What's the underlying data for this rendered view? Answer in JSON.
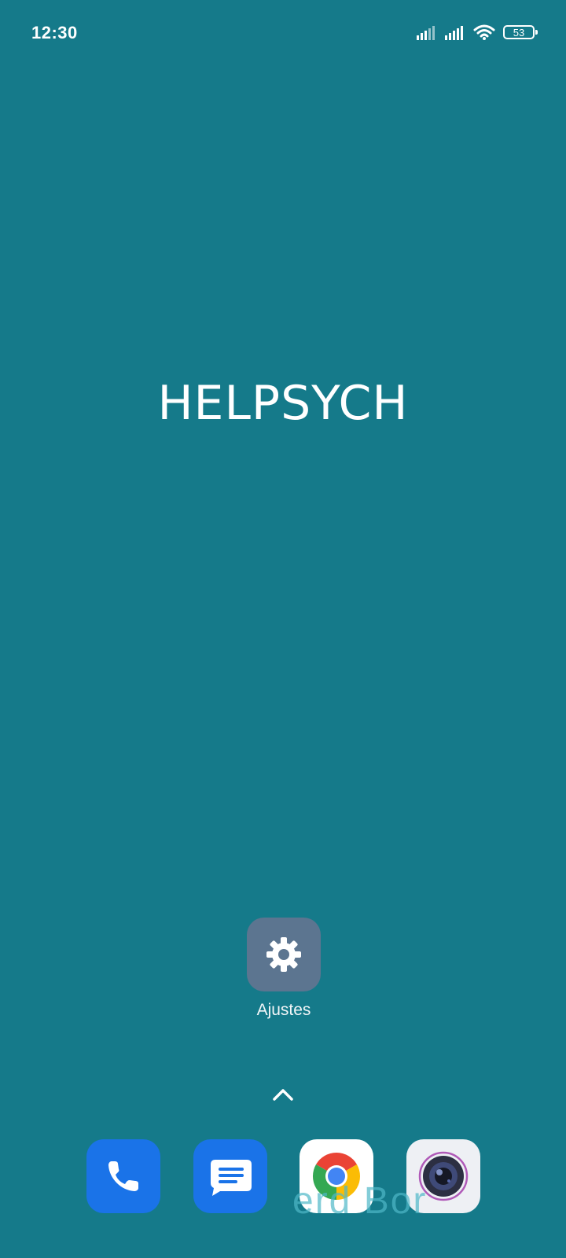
{
  "status_bar": {
    "time": "12:30",
    "battery_level": "53",
    "icons": [
      "signal-icon",
      "signal-icon",
      "wifi-icon",
      "battery-icon"
    ]
  },
  "home": {
    "wallpaper_title": "HELPSYCH",
    "apps": [
      {
        "label": "Ajustes",
        "icon": "settings-gear-icon",
        "color": "#5c7590"
      }
    ]
  },
  "dock": {
    "apps": [
      {
        "icon": "phone-icon",
        "color": "#1a73e8"
      },
      {
        "icon": "messages-icon",
        "color": "#1a73e8"
      },
      {
        "icon": "chrome-icon",
        "color": "#ffffff"
      },
      {
        "icon": "camera-icon",
        "color": "#eef0f4"
      }
    ]
  },
  "watermark": "erd Bor"
}
